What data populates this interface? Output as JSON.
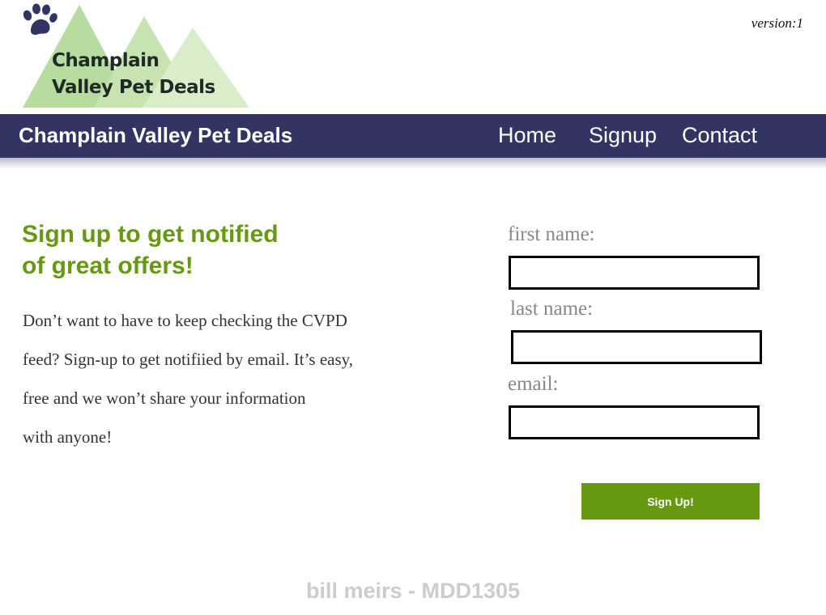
{
  "version_label": "version:1",
  "logo": {
    "line1": "Champlain",
    "line2": "Valley Pet Deals",
    "icon": "paw-print-icon"
  },
  "navbar": {
    "title": "Champlain Valley Pet Deals",
    "links": [
      {
        "label": "Home"
      },
      {
        "label": "Signup"
      },
      {
        "label": "Contact"
      }
    ]
  },
  "main": {
    "headline_line1": "Sign up to get notified",
    "headline_line2": "of great offers!",
    "body_lines": [
      "Don’t want to have to keep checking the CVPD",
      "feed? Sign-up to get notifiied by email. It’s easy,",
      "free and we won’t share your information",
      "with anyone!"
    ]
  },
  "form": {
    "first_name_label": "first name:",
    "first_name_value": "",
    "last_name_label": "last name:",
    "last_name_value": "",
    "email_label": "email:",
    "email_value": "",
    "submit_label": "Sign Up!"
  },
  "footer": {
    "credit": "bill meirs - MDD1305"
  },
  "colors": {
    "navbar_bg": "#323564",
    "accent_green": "#669910",
    "label_gray": "#888888",
    "footer_gray": "#cccccc"
  }
}
